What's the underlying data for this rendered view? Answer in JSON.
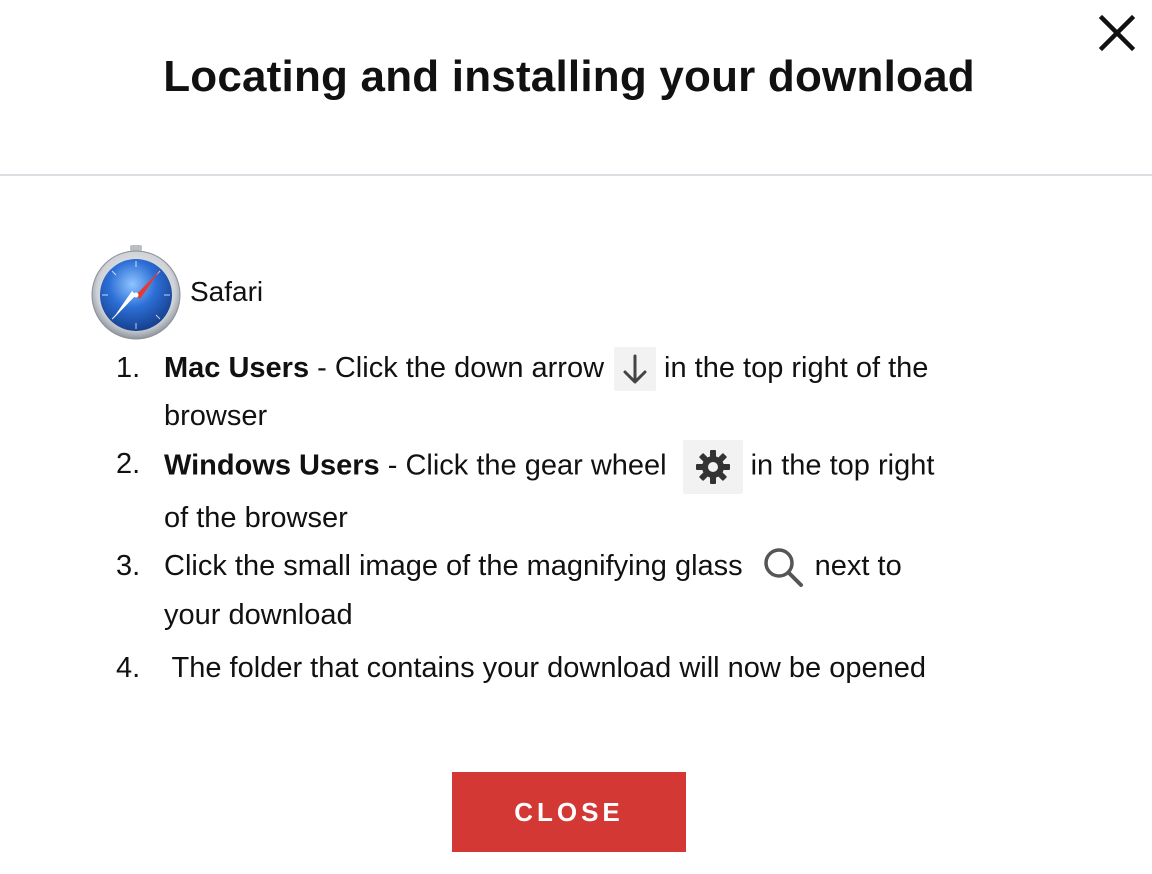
{
  "dialog": {
    "title": "Locating and installing your download",
    "close_icon": "close-icon",
    "close_button_label": "CLOSE",
    "accent_color": "#d43834"
  },
  "browser": {
    "name": "Safari",
    "icon": "safari-compass-icon"
  },
  "steps": [
    {
      "number": "1.",
      "bold": "Mac Users",
      "before": " - Click the down arrow",
      "icon": "down-arrow-icon",
      "after": "in the top right of the",
      "continuation": "browser"
    },
    {
      "number": "2.",
      "bold": "Windows Users",
      "before": " - Click the gear wheel",
      "icon": "gear-icon",
      "after": "in the top right",
      "continuation": "of the browser"
    },
    {
      "number": "3.",
      "before": "Click the small image of the magnifying glass",
      "icon": "magnifying-glass-icon",
      "after": "next to",
      "continuation": "your download"
    },
    {
      "number": "4.",
      "text": " The folder that contains your download will now be opened"
    }
  ]
}
